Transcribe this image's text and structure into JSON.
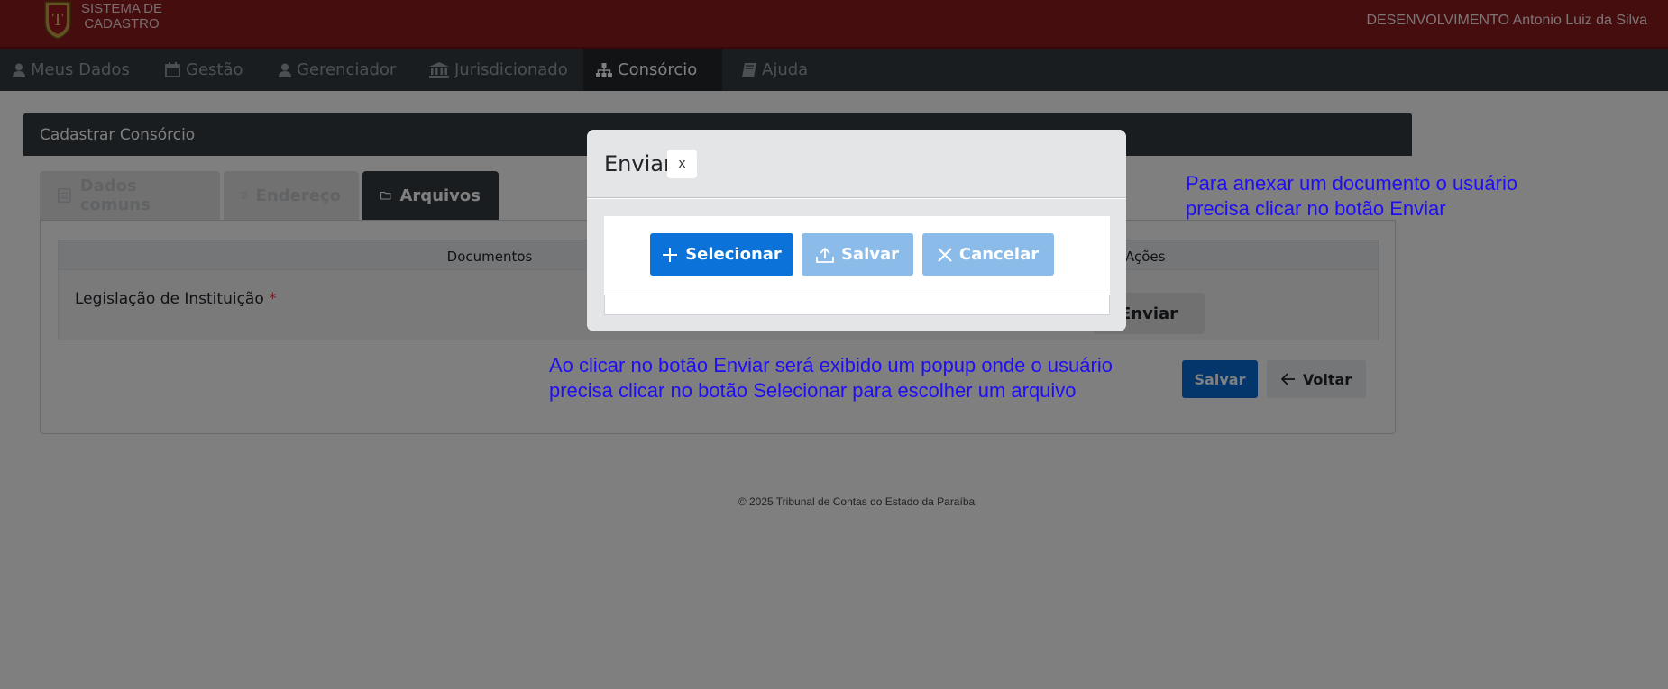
{
  "header": {
    "logo_text_line1": "SISTEMA DE",
    "logo_text_line2": "CADASTRO",
    "user_info": "DESENVOLVIMENTO Antonio Luiz da Silva"
  },
  "nav": {
    "items": [
      {
        "label": "Meus Dados",
        "icon": "user-icon"
      },
      {
        "label": "Gestão",
        "icon": "calendar-icon"
      },
      {
        "label": "Gerenciador",
        "icon": "user-icon"
      },
      {
        "label": "Jurisdicionado",
        "icon": "bank-icon"
      },
      {
        "label": "Consórcio",
        "icon": "sitemap-icon",
        "active": true
      },
      {
        "label": "Ajuda",
        "icon": "book-icon"
      }
    ]
  },
  "card": {
    "title": "Cadastrar Consórcio",
    "tabs": [
      {
        "label": "Dados comuns",
        "icon": "list-icon"
      },
      {
        "label": "Endereço",
        "icon": "building-icon"
      },
      {
        "label": "Arquivos",
        "icon": "folder-icon",
        "active": true
      }
    ],
    "table": {
      "col_documentos": "Documentos",
      "col_acoes": "Ações",
      "rows": [
        {
          "label": "Legislação de Instituição",
          "required_mark": "*",
          "action": "Enviar"
        }
      ]
    },
    "salvar_label": "Salvar",
    "voltar_label": "Voltar"
  },
  "footer": {
    "text": "© 2025 Tribunal de Contas do Estado da Paraíba"
  },
  "annotations": {
    "top_right": "Para anexar um documento o usuário\nprecisa clicar no botão Enviar",
    "middle": "Ao clicar no botão Enviar será exibido um popup onde o usuário\nprecisa clicar no botão Selecionar para escolher um arquivo"
  },
  "modal": {
    "title": "Enviar",
    "close_label": "x",
    "selecionar_label": "Selecionar",
    "salvar_label": "Salvar",
    "cancelar_label": "Cancelar"
  },
  "colors": {
    "header_bg": "#8c1a1f",
    "nav_bg": "#343a40",
    "primary": "#0a72d8",
    "annotation": "#1f0ef4"
  }
}
